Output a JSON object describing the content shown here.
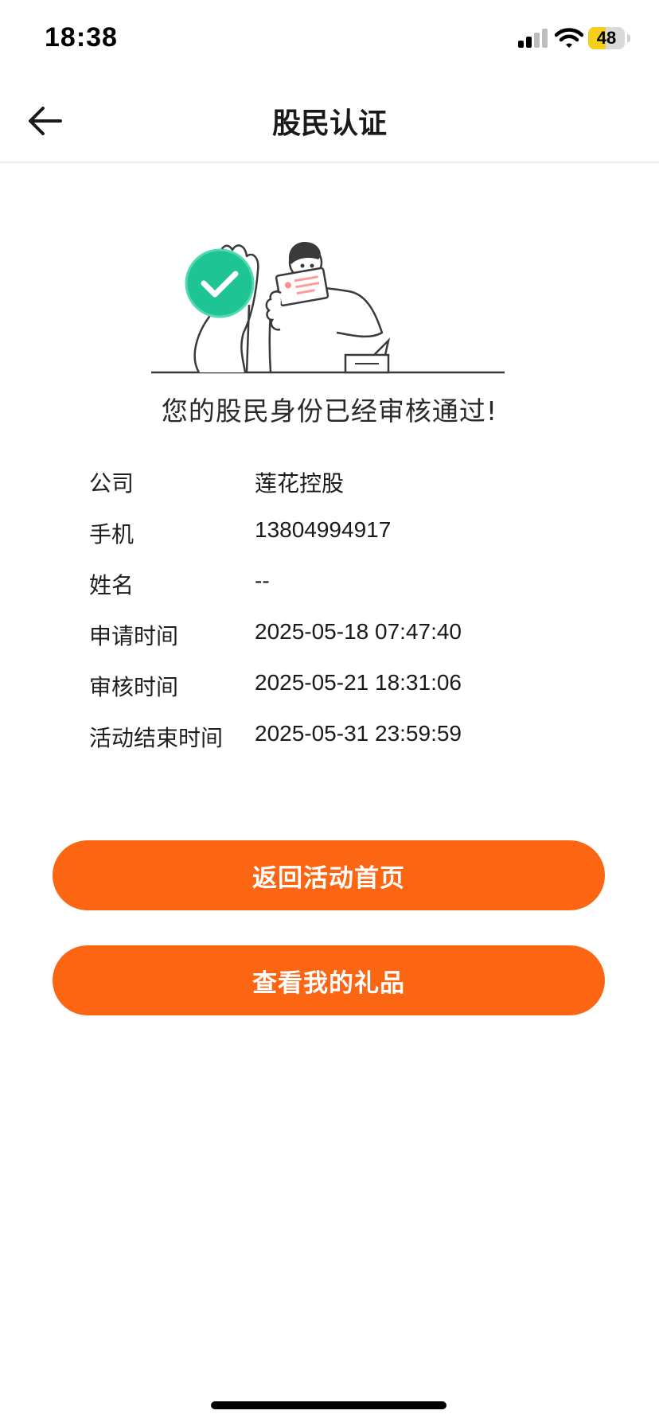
{
  "status_bar": {
    "time": "18:38",
    "battery_level": "48",
    "battery_fraction": 0.48,
    "icons": [
      "signal-icon",
      "wifi-icon",
      "battery-icon"
    ]
  },
  "nav": {
    "back_icon": "back-arrow-icon",
    "title": "股民认证"
  },
  "result": {
    "illustration": "verified-person-with-card-illustration",
    "message": "您的股民身份已经审核通过!"
  },
  "info": {
    "rows": [
      {
        "label": "公司",
        "value": "莲花控股"
      },
      {
        "label": "手机",
        "value": "13804994917"
      },
      {
        "label": "姓名",
        "value": "--"
      },
      {
        "label": "申请时间",
        "value": "2025-05-18 07:47:40"
      },
      {
        "label": "审核时间",
        "value": "2025-05-21 18:31:06"
      },
      {
        "label": "活动结束时间",
        "value": "2025-05-31 23:59:59"
      }
    ]
  },
  "actions": {
    "home_label": "返回活动首页",
    "gifts_label": "查看我的礼品"
  },
  "colors": {
    "accent": "#fc6512",
    "success": "#1fc495",
    "text": "#1a1a1a",
    "divider": "#eeeeee",
    "battery": "#f5cf1a"
  }
}
